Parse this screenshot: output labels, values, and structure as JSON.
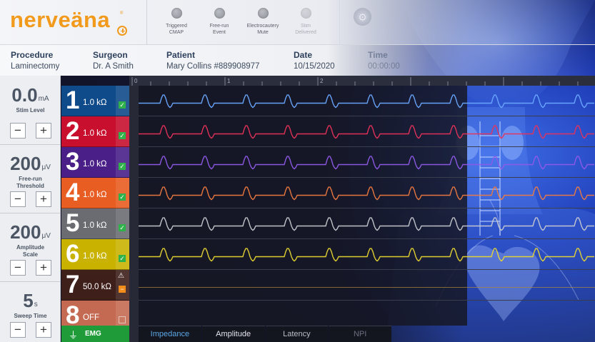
{
  "app": {
    "logo_text": "nerveäna",
    "logo_reg": "®"
  },
  "indicators": [
    {
      "label_line1": "Triggered",
      "label_line2": "CMAP"
    },
    {
      "label_line1": "Free-run",
      "label_line2": "Event"
    },
    {
      "label_line1": "Electrocautery",
      "label_line2": "Mute"
    },
    {
      "label_line1": "Stim",
      "label_line2": "Delivered"
    }
  ],
  "info": {
    "procedure": {
      "label": "Procedure",
      "value": "Laminectomy"
    },
    "surgeon": {
      "label": "Surgeon",
      "value": "Dr. A Smith"
    },
    "patient": {
      "label": "Patient",
      "value": "Mary Collins  #889908977"
    },
    "date": {
      "label": "Date",
      "value": "10/15/2020"
    },
    "time": {
      "label": "Time",
      "value": "00:00:00"
    }
  },
  "controls": [
    {
      "value": "0.0",
      "unit": "mA",
      "name_line1": "Stim Level",
      "name_line2": ""
    },
    {
      "value": "200",
      "unit": "μV",
      "name_line1": "Free-run",
      "name_line2": "Threshold"
    },
    {
      "value": "200",
      "unit": "μV",
      "name_line1": "Amplitude",
      "name_line2": "Scale"
    },
    {
      "value": "5",
      "unit": "s",
      "name_line1": "Sweep Time",
      "name_line2": ""
    }
  ],
  "buttons": {
    "minus": "−",
    "plus": "+"
  },
  "channels": [
    {
      "number": "1",
      "impedance": "1.0 kΩ",
      "status": "ok",
      "color": "#0f4a8a",
      "trace_color": "#6aa8ff"
    },
    {
      "number": "2",
      "impedance": "1.0 kΩ",
      "status": "ok",
      "color": "#c8102e",
      "trace_color": "#e8315a"
    },
    {
      "number": "3",
      "impedance": "1.0 kΩ",
      "status": "ok",
      "color": "#4a2088",
      "trace_color": "#8f5ae8"
    },
    {
      "number": "4",
      "impedance": "1.0 kΩ",
      "status": "ok",
      "color": "#e85d22",
      "trace_color": "#f07a40"
    },
    {
      "number": "5",
      "impedance": "1.0 kΩ",
      "status": "ok",
      "color": "#6b6c72",
      "trace_color": "#c8cad0"
    },
    {
      "number": "6",
      "impedance": "1.0 kΩ",
      "status": "ok",
      "color": "#c9b300",
      "trace_color": "#e8d630"
    },
    {
      "number": "7",
      "impedance": "50.0 kΩ",
      "status": "warning",
      "color": "#3e1f1a",
      "trace_color": "#b08a3a"
    },
    {
      "number": "8",
      "impedance": "OFF",
      "status": "off",
      "color": "#c46a52",
      "trace_color": ""
    }
  ],
  "emg": {
    "label": "EMG",
    "icon": "ground-icon"
  },
  "ruler": {
    "ticks": [
      "0",
      "1",
      "2"
    ]
  },
  "tabs": [
    "Impedance",
    "Amplitude",
    "Latency",
    "NPI"
  ]
}
